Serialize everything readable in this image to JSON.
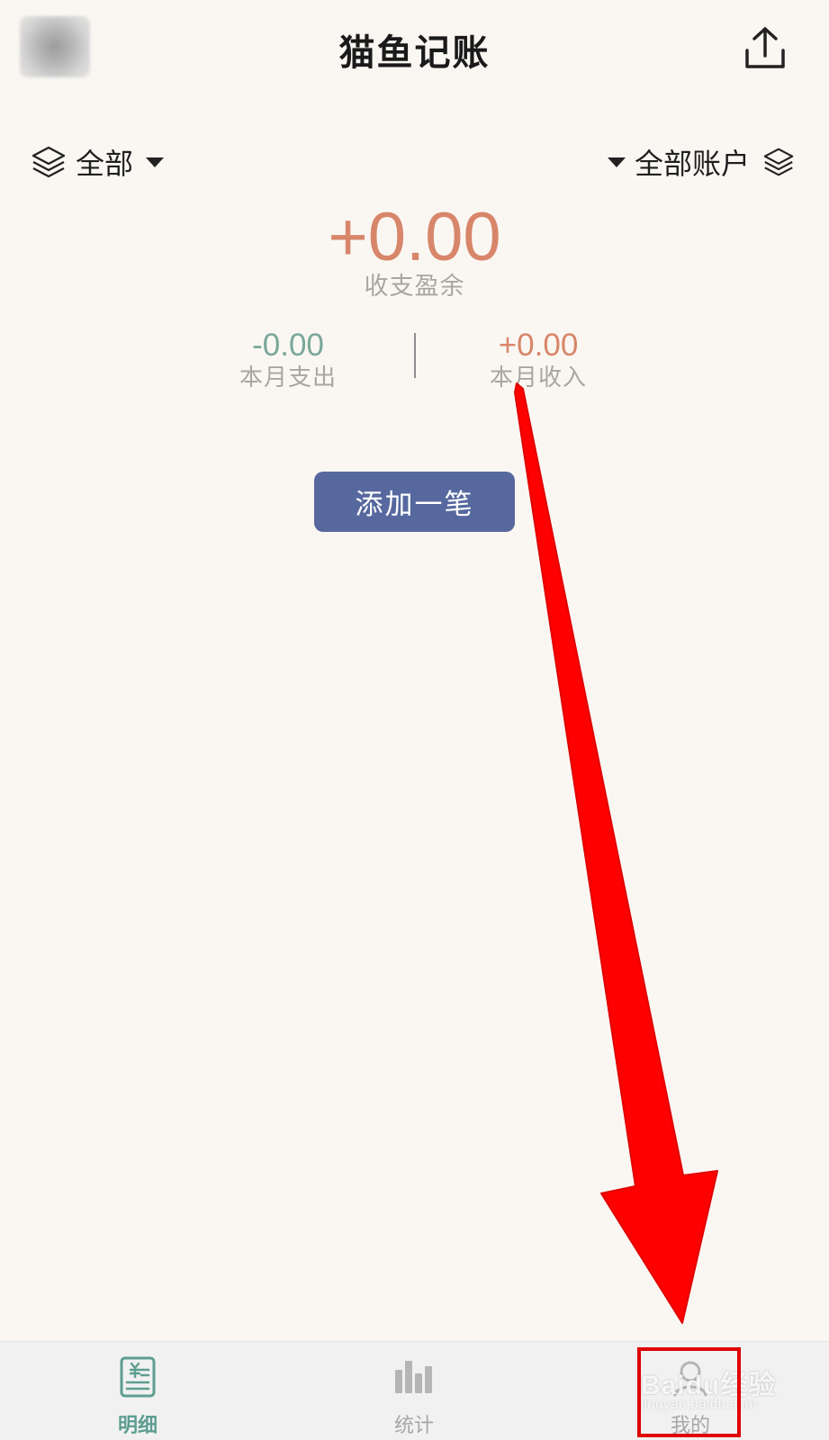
{
  "header": {
    "title": "猫鱼记账",
    "share_icon": "share-upload-icon"
  },
  "filters": {
    "category_label": "全部",
    "account_label": "全部账户"
  },
  "summary": {
    "balance": "+0.00",
    "balance_label": "收支盈余",
    "expense_value": "-0.00",
    "expense_label": "本月支出",
    "income_value": "+0.00",
    "income_label": "本月收入"
  },
  "actions": {
    "add_label": "添加一笔"
  },
  "bottom_nav": {
    "items": [
      {
        "label": "明细",
        "icon": "ledger-icon",
        "active": true
      },
      {
        "label": "统计",
        "icon": "bar-chart-icon",
        "active": false
      },
      {
        "label": "我的",
        "icon": "profile-icon",
        "active": false
      }
    ]
  },
  "watermark": {
    "brand": "Baidu经验",
    "site": "jingyan.baidu.com"
  },
  "colors": {
    "background": "#faf7f3",
    "accent_income": "#d8866a",
    "accent_expense": "#7aa79a",
    "button": "#56689e",
    "nav_active": "#5d9e90",
    "annotation": "#e00000"
  }
}
